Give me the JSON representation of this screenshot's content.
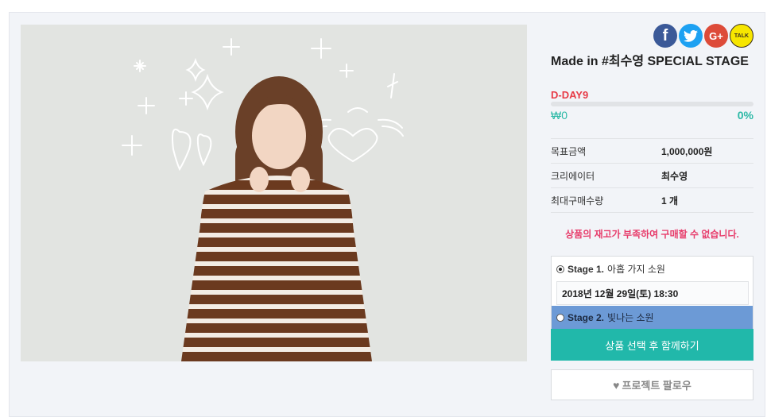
{
  "share": {
    "facebook": {
      "label": "f",
      "icon": "facebook-icon",
      "color": "#3b5998"
    },
    "twitter": {
      "label": "t",
      "icon": "twitter-icon",
      "color": "#1da1f2"
    },
    "googleplus": {
      "label": "G+",
      "icon": "google-plus-icon",
      "color": "#dd4b39"
    },
    "kakaotalk": {
      "label": "TALK",
      "icon": "kakaotalk-icon",
      "color": "#f7e600"
    }
  },
  "product": {
    "title": "Made in #최수영 SPECIAL STAGE",
    "dday": "D-DAY9",
    "progress_percent": 0,
    "amount": "₩0",
    "percent_label": "0%"
  },
  "info": [
    {
      "label": "목표금액",
      "value": "1,000,000원"
    },
    {
      "label": "크리에이터",
      "value": "최수영"
    },
    {
      "label": "최대구매수량",
      "value": "1 개"
    }
  ],
  "stock_notice": "상품의 재고가 부족하여 구매할 수 없습니다.",
  "options": {
    "option1": {
      "name": "Stage 1.",
      "desc": "아홉 가지 소원",
      "selected": true
    },
    "date": "2018년 12월 29일(토) 18:30",
    "option2": {
      "name": "Stage 2.",
      "desc": "빛나는 소원",
      "selected": false
    }
  },
  "buttons": {
    "join": "상품 선택 후 함께하기",
    "follow": "프로젝트 팔로우"
  },
  "colors": {
    "accent": "#21b8aa",
    "dday": "#e73b47",
    "notice": "#e73b6a",
    "highlight": "#6c9ad6"
  }
}
